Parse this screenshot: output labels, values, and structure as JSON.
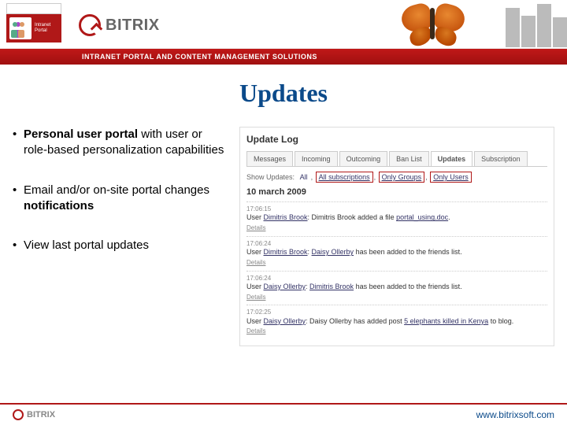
{
  "header": {
    "brand": "BITRIX",
    "tagline": "INTRANET PORTAL AND CONTENT MANAGEMENT SOLUTIONS"
  },
  "title": "Updates",
  "bullets": [
    {
      "prefix": "Personal user portal",
      "rest": " with user or role-based personalization capabilities"
    },
    {
      "prefix": "",
      "rest_a": "Email and/or on-site portal changes ",
      "bold": "notifications"
    },
    {
      "plain": "View last portal updates"
    }
  ],
  "screenshot": {
    "heading": "Update Log",
    "tabs": [
      "Messages",
      "Incoming",
      "Outcoming",
      "Ban List",
      "Updates",
      "Subscription"
    ],
    "active_tab": "Updates",
    "filter_label": "Show Updates:",
    "filters": [
      "All",
      "All subscriptions",
      "Only Groups",
      "Only Users"
    ],
    "date": "10 march 2009",
    "entries": [
      {
        "time": "17:06:15",
        "who": "Dimitris Brook",
        "text": ": Dimitris Brook added a file ",
        "link": "portal_using.doc",
        "suffix": "."
      },
      {
        "time": "17:06:24",
        "who": "Dimitris Brook",
        "text": ": ",
        "link": "Daisy Ollerby",
        "suffix": " has been added to the friends list."
      },
      {
        "time": "17:06:24",
        "who": "Daisy Ollerby",
        "text": ": ",
        "link": "Dimitris Brook",
        "suffix": " has been added to the friends list."
      },
      {
        "time": "17:02:25",
        "who": "Daisy Ollerby",
        "text": ": Daisy Ollerby has added post ",
        "link": "5 elephants killed in Kenya",
        "suffix": " to blog."
      }
    ],
    "details_label": "Details"
  },
  "footer": {
    "brand": "BITRIX",
    "url": "www.bitrixsoft.com"
  }
}
